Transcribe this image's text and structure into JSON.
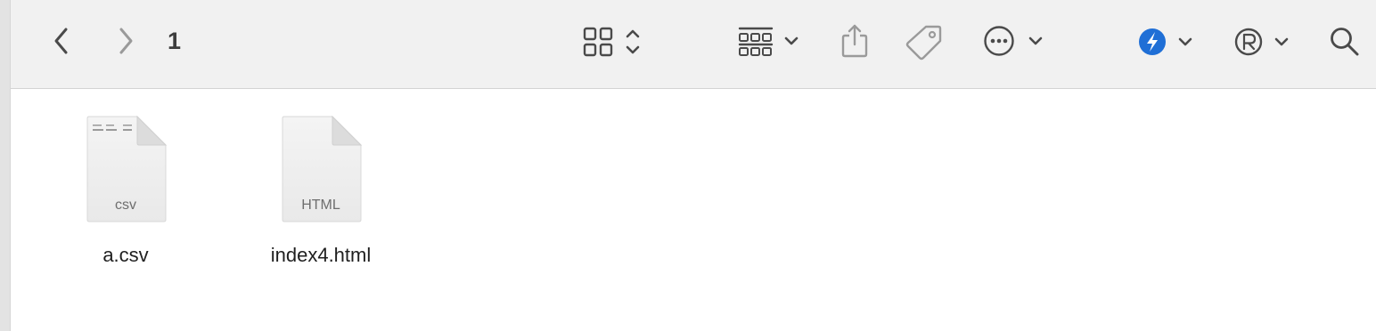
{
  "window": {
    "title": "1"
  },
  "toolbar": {
    "back": "chevron-left-icon",
    "forward": "chevron-right-icon",
    "view": "grid-view-icon",
    "group": "group-by-icon",
    "share": "share-icon",
    "tags": "tag-icon",
    "actions": "more-actions-icon",
    "extension_1": "bolt-icon",
    "extension_2": "r-circle-icon",
    "search": "search-icon",
    "accent_color": "#1f6fd6"
  },
  "files": [
    {
      "name": "a.csv",
      "ext_label": "csv"
    },
    {
      "name": "index4.html",
      "ext_label": "HTML"
    }
  ]
}
